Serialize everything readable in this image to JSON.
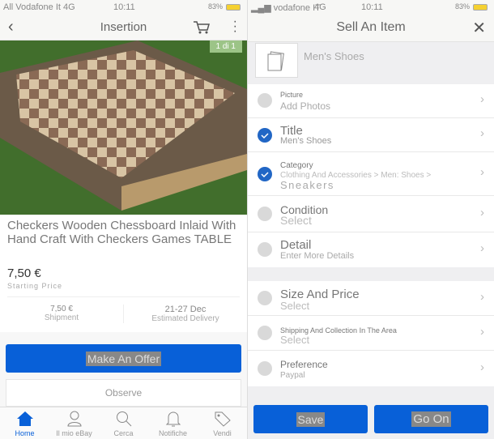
{
  "left": {
    "status": {
      "carrier": "All Vodafone It 4G",
      "time": "10:11",
      "battery": "83%"
    },
    "header": {
      "title": "Insertion",
      "back_icon": "chevron-left-icon",
      "cart_icon": "cart-icon",
      "more_icon": "more-vertical-icon"
    },
    "image": {
      "page_indicator": "1 di 1"
    },
    "item": {
      "title": "Checkers Wooden Chessboard Inlaid With Hand Craft With Checkers Games TABLE",
      "price": "7,50 €",
      "price_label": "Starting Price",
      "shipment_value": "7,50 €",
      "shipment_label": "Shipment",
      "delivery_value": "21-27 Dec",
      "delivery_label": "Estimated Delivery"
    },
    "make_offer": "Make An Offer",
    "observe": "Observe",
    "tabs": [
      {
        "label": "Home",
        "icon": "home-icon",
        "active": true
      },
      {
        "label": "Il mio eBay",
        "icon": "user-icon"
      },
      {
        "label": "Cerca",
        "icon": "search-icon"
      },
      {
        "label": "Notifiche",
        "icon": "bell-icon"
      },
      {
        "label": "Vendi",
        "icon": "tag-icon"
      }
    ],
    "accent": "#0860d8"
  },
  "right": {
    "status": {
      "carrier": "vodafone IT",
      "network": "4G",
      "time": "10:11",
      "battery": "83%"
    },
    "header": {
      "title": "Sell An Item",
      "close_icon": "close-icon"
    },
    "item_name": "Men's Shoes",
    "rows": [
      {
        "label": "Picture",
        "value": "Add Photos",
        "checked": false
      },
      {
        "label": "Title",
        "value": "Men's Shoes",
        "checked": true
      },
      {
        "label": "Category",
        "value": "Clothing And Accessories > Men: Shoes >",
        "value2": "Sneakers",
        "checked": true
      },
      {
        "label": "Condition",
        "value": "Select",
        "checked": false
      },
      {
        "label": "Detail",
        "value": "Enter More Details",
        "checked": false
      },
      {
        "label": "Size And Price",
        "value": "Select",
        "checked": false
      },
      {
        "label": "Shipping And Collection In The Area",
        "value": "Select",
        "checked": false
      },
      {
        "label": "Preference",
        "value": "Paypal",
        "checked": false
      }
    ],
    "save": "Save",
    "go_on": "Go On"
  }
}
